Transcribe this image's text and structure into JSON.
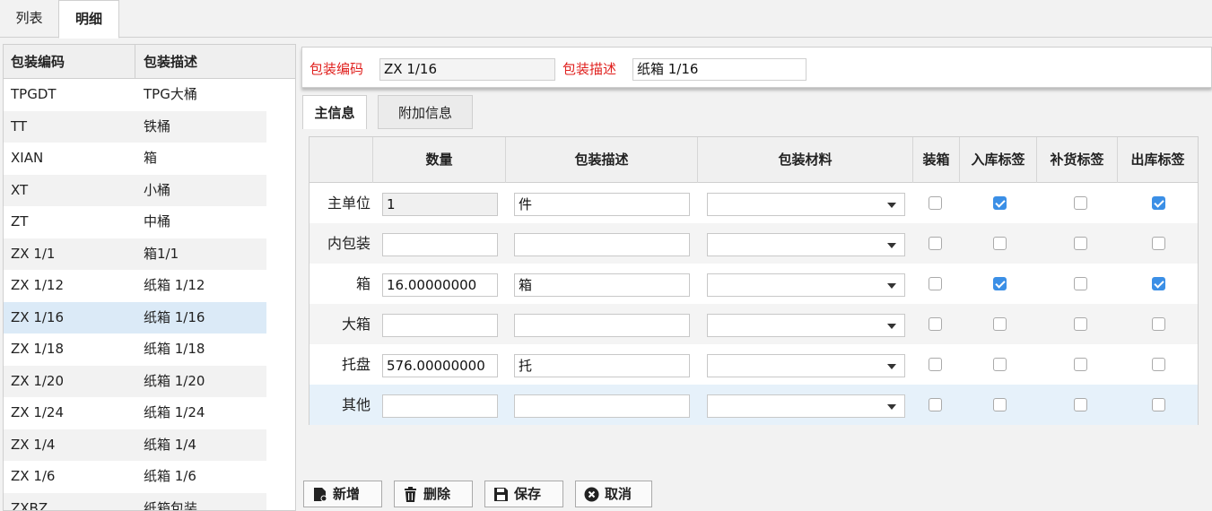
{
  "top_tabs": [
    "列表",
    "明细"
  ],
  "list": {
    "headers": [
      "包装编码",
      "包装描述"
    ],
    "rows": [
      [
        "TPGDT",
        "TPG大桶"
      ],
      [
        "TT",
        "铁桶"
      ],
      [
        "XIAN",
        "箱"
      ],
      [
        "XT",
        "小桶"
      ],
      [
        "ZT",
        "中桶"
      ],
      [
        "ZX 1/1",
        "箱1/1"
      ],
      [
        "ZX 1/12",
        "纸箱 1/12"
      ],
      [
        "ZX 1/16",
        "纸箱 1/16"
      ],
      [
        "ZX 1/18",
        "纸箱 1/18"
      ],
      [
        "ZX 1/20",
        "纸箱 1/20"
      ],
      [
        "ZX 1/24",
        "纸箱 1/24"
      ],
      [
        "ZX 1/4",
        "纸箱 1/4"
      ],
      [
        "ZX 1/6",
        "纸箱 1/6"
      ],
      [
        "ZXBZ",
        "纸箱包装"
      ]
    ]
  },
  "header": {
    "code_label": "包装编码",
    "code_value": "ZX 1/16",
    "desc_label": "包装描述",
    "desc_value": "纸箱 1/16"
  },
  "sub_tabs": [
    "主信息",
    "附加信息"
  ],
  "grid": {
    "headers": [
      "",
      "数量",
      "包装描述",
      "包装材料",
      "装箱",
      "入库标签",
      "补货标签",
      "出库标签"
    ],
    "rows": [
      {
        "label": "主单位",
        "qty": "1",
        "desc": "件",
        "material": "",
        "box": false,
        "in": true,
        "replenish": false,
        "out": true
      },
      {
        "label": "内包装",
        "qty": "",
        "desc": "",
        "material": "",
        "box": false,
        "in": false,
        "replenish": false,
        "out": false
      },
      {
        "label": "箱",
        "qty": "16.00000000",
        "desc": "箱",
        "material": "",
        "box": false,
        "in": true,
        "replenish": false,
        "out": true
      },
      {
        "label": "大箱",
        "qty": "",
        "desc": "",
        "material": "",
        "box": false,
        "in": false,
        "replenish": false,
        "out": false
      },
      {
        "label": "托盘",
        "qty": "576.00000000",
        "desc": "托",
        "material": "",
        "box": false,
        "in": false,
        "replenish": false,
        "out": false
      },
      {
        "label": "其他",
        "qty": "",
        "desc": "",
        "material": "",
        "box": false,
        "in": false,
        "replenish": false,
        "out": false
      }
    ]
  },
  "buttons": {
    "add": "新增",
    "delete": "删除",
    "save": "保存",
    "cancel": "取消"
  },
  "colors": {
    "required_label": "#e0201e",
    "checkbox_on": "#3b8fe6",
    "selected_row": "#dbeaf7"
  }
}
